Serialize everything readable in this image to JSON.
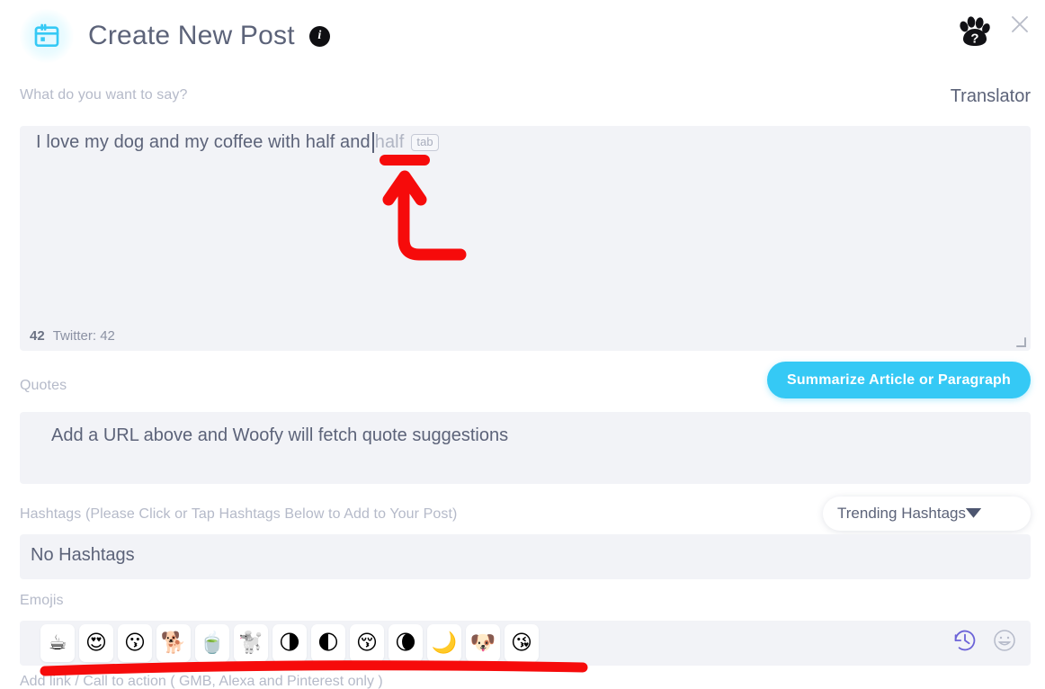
{
  "header": {
    "title": "Create New Post",
    "calendar_icon": "calendar-icon",
    "info_icon": "info-icon",
    "info_glyph": "i",
    "paw_icon": "paw-help-icon",
    "close_icon": "close-icon",
    "accent_color": "#35c9f5",
    "title_color": "#5c6379"
  },
  "compose": {
    "label": "What do you want to say?",
    "translator_label": "Translator",
    "typed_text": "I love my dog and my coffee with half and",
    "suggestion_text": "half",
    "suggestion_key": "tab",
    "char_count": "42",
    "platform_count": "Twitter: 42",
    "resize_handle": "resize-grip"
  },
  "summarize": {
    "label": "Summarize Article or Paragraph",
    "color": "#35c9f5"
  },
  "quotes": {
    "label": "Quotes",
    "placeholder": "Add a URL above and Woofy will fetch quote suggestions"
  },
  "hashtags": {
    "label": "Hashtags (Please Click or Tap Hashtags Below to Add to Your Post)",
    "empty_text": "No Hashtags",
    "dropdown_value": "Trending Hashtags",
    "dropdown_icon": "chevron-down-icon"
  },
  "emojis": {
    "label": "Emojis",
    "items": [
      {
        "name": "emoji-hot-beverage",
        "glyph": "☕"
      },
      {
        "name": "emoji-smiling-face-with-heart-eyes",
        "glyph": "😍"
      },
      {
        "name": "emoji-kissing-face",
        "glyph": "😗"
      },
      {
        "name": "emoji-dog",
        "glyph": "🐕"
      },
      {
        "name": "emoji-teacup-without-handle",
        "glyph": "🍵"
      },
      {
        "name": "emoji-poodle",
        "glyph": "🐩"
      },
      {
        "name": "emoji-last-quarter-moon",
        "glyph": "🌗"
      },
      {
        "name": "emoji-first-quarter-moon",
        "glyph": "🌓"
      },
      {
        "name": "emoji-kissing-face-with-closed-eyes",
        "glyph": "😚"
      },
      {
        "name": "emoji-waning-crescent-moon",
        "glyph": "🌘"
      },
      {
        "name": "emoji-crescent-moon",
        "glyph": "🌙"
      },
      {
        "name": "emoji-dog-face",
        "glyph": "🐶"
      },
      {
        "name": "emoji-face-blowing-a-kiss",
        "glyph": "😘"
      }
    ],
    "recent_icon": "history-clock-icon",
    "picker_icon": "smiley-face-icon",
    "recent_color": "#6c63d8",
    "picker_color": "#b5bac9"
  },
  "footer": {
    "label": "Add link / Call to action ( GMB, Alexa and Pinterest only )"
  },
  "annotations": {
    "color": "#f60b0b",
    "arrow_name": "red-arrow-annotation",
    "underline_top_name": "red-underline-suggestion",
    "underline_bottom_name": "red-underline-emoji-bar"
  }
}
